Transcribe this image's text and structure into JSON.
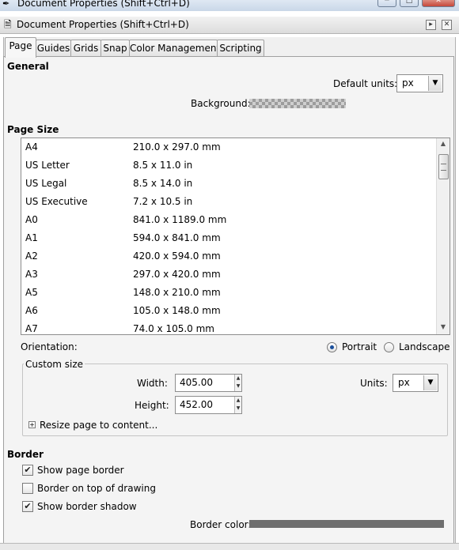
{
  "os_window": {
    "title": "Document Properties (Shift+Ctrl+D)",
    "buttons": [
      "─",
      "□",
      "✕"
    ]
  },
  "panel": {
    "title": "Document Properties (Shift+Ctrl+D)",
    "buttons": [
      "▸",
      "✕"
    ]
  },
  "tabs": [
    "Page",
    "Guides",
    "Grids",
    "Snap",
    "Color Management",
    "Scripting"
  ],
  "active_tab": "Page",
  "general": {
    "title": "General",
    "default_units_label": "Default units:",
    "default_units_value": "px",
    "background_label": "Background:"
  },
  "page_size": {
    "title": "Page Size",
    "rows": [
      {
        "name": "A4",
        "size": "210.0 x 297.0 mm"
      },
      {
        "name": "US Letter",
        "size": "8.5 x 11.0 in"
      },
      {
        "name": "US Legal",
        "size": "8.5 x 14.0 in"
      },
      {
        "name": "US Executive",
        "size": "7.2 x 10.5 in"
      },
      {
        "name": "A0",
        "size": "841.0 x 1189.0 mm"
      },
      {
        "name": "A1",
        "size": "594.0 x 841.0 mm"
      },
      {
        "name": "A2",
        "size": "420.0 x 594.0 mm"
      },
      {
        "name": "A3",
        "size": "297.0 x 420.0 mm"
      },
      {
        "name": "A5",
        "size": "148.0 x 210.0 mm"
      },
      {
        "name": "A6",
        "size": "105.0 x 148.0 mm"
      },
      {
        "name": "A7",
        "size": "74.0 x 105.0 mm"
      }
    ],
    "orientation_label": "Orientation:",
    "portrait_label": "Portrait",
    "landscape_label": "Landscape",
    "orientation_selected": "Portrait",
    "custom_size": {
      "title": "Custom size",
      "width_label": "Width:",
      "width_value": "405.00",
      "height_label": "Height:",
      "height_value": "452.00",
      "units_label": "Units:",
      "units_value": "px",
      "resize_label": "Resize page to content..."
    }
  },
  "border": {
    "title": "Border",
    "show_page_border": {
      "label": "Show page border",
      "checked": true
    },
    "border_on_top": {
      "label": "Border on top of drawing",
      "checked": false
    },
    "show_border_shadow": {
      "label": "Show border shadow",
      "checked": true
    },
    "border_color_label": "Border color:",
    "border_color": "#6e6e6e"
  },
  "icons": {
    "check": "✔",
    "combo_arrow": "▼",
    "scroll_up": "▲",
    "scroll_down": "▼",
    "spin_up": "▲",
    "spin_down": "▼",
    "expander": "+"
  }
}
